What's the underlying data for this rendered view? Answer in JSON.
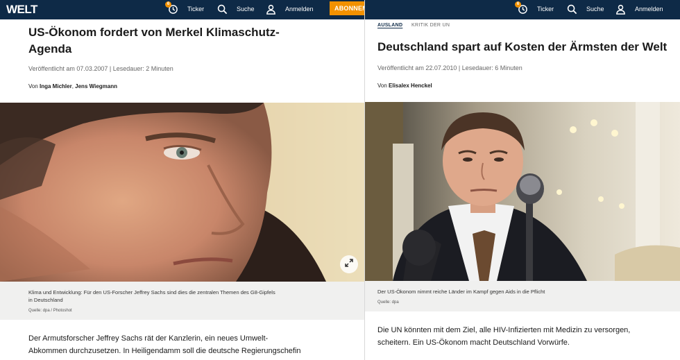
{
  "left": {
    "nav": {
      "logo": "WELT",
      "ticker_badge": "6",
      "ticker_label": "Ticker",
      "search_label": "Suche",
      "login_label": "Anmelden",
      "subscribe_label": "ABONNEM"
    },
    "article": {
      "title_line1": "US-Ökonom fordert von Merkel Klimaschutz-",
      "title_line2": "Agenda",
      "published": "Veröffentlicht am 07.03.2007 | Lesedauer: 2 Minuten",
      "authors_prefix": "Von ",
      "author1": "Inga Michler",
      "author_sep": ", ",
      "author2": "Jens Wiegmann",
      "caption_line1": "Klima und Entwicklung: Für den US-Forscher Jeffrey Sachs sind dies die zentralen Themen des G8-Gipfels",
      "caption_line2": "in Deutschland",
      "credit": "Quelle: dpa / Photoshot",
      "lead_line1": "Der Armutsforscher Jeffrey Sachs rät der Kanzlerin, ein neues Umwelt-",
      "lead_line2": "Abkommen durchzusetzen. In Heiligendamm soll die deutsche Regierungschefin"
    }
  },
  "right": {
    "nav": {
      "ticker_badge": "6",
      "ticker_label": "Ticker",
      "search_label": "Suche",
      "login_label": "Anmelden"
    },
    "article": {
      "kicker": "AUSLAND",
      "kicker2": "KRITIK DER UN",
      "title": "Deutschland spart auf Kosten der Ärmsten der Welt",
      "published": "Veröffentlicht am 22.07.2010 | Lesedauer: 6 Minuten",
      "authors_prefix": "Von ",
      "author1": "Elisalex Henckel",
      "caption": "Der US-Ökonom nimmt reiche Länder im Kampf gegen Aids in die Pflicht",
      "credit": "Quelle: dpa",
      "lead_line1": "Die UN könnten mit dem Ziel, alle HIV-Infizierten mit Medizin zu versorgen,",
      "lead_line2": "scheitern. Ein US-Ökonom macht Deutschland Vorwürfe."
    }
  },
  "colors": {
    "nav_bg": "#0e2a47",
    "accent": "#f29100",
    "caption_bg": "#f0f0ef"
  },
  "icons": [
    "clock-icon",
    "search-icon",
    "user-icon",
    "expand-icon"
  ]
}
